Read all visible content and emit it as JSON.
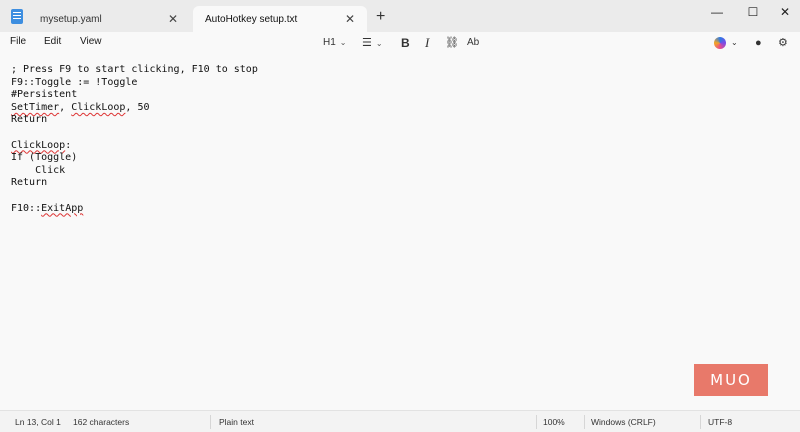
{
  "tabs": [
    {
      "label": "mysetup.yaml",
      "active": false
    },
    {
      "label": "AutoHotkey setup.txt",
      "active": true
    }
  ],
  "new_tab_glyph": "+",
  "tab_close_glyph": "✕",
  "window_controls": {
    "minimize": "—",
    "maximize": "☐",
    "close": "✕"
  },
  "menu": {
    "file": "File",
    "edit": "Edit",
    "view": "View"
  },
  "toolbar": {
    "heading": "H1",
    "list_glyph": "☰",
    "bold": "B",
    "italic": "I",
    "link_glyph": "⛓",
    "spellcheck": "Ab"
  },
  "code_lines": [
    [
      {
        "t": "; Press F9 to start clicking, F10 to stop"
      }
    ],
    [
      {
        "t": "F9::Toggle := !Toggle"
      }
    ],
    [
      {
        "t": "#Persistent"
      }
    ],
    [
      {
        "t": "SetTimer",
        "err": true
      },
      {
        "t": ", "
      },
      {
        "t": "ClickLoop",
        "err": true
      },
      {
        "t": ", 50"
      }
    ],
    [
      {
        "t": "Return"
      }
    ],
    [
      {
        "t": ""
      }
    ],
    [
      {
        "t": "ClickLoop",
        "err": true
      },
      {
        "t": ":"
      }
    ],
    [
      {
        "t": "If (Toggle)"
      }
    ],
    [
      {
        "t": "    Click"
      }
    ],
    [
      {
        "t": "Return"
      }
    ],
    [
      {
        "t": ""
      }
    ],
    [
      {
        "t": "F10::"
      },
      {
        "t": "ExitApp",
        "err": true
      }
    ]
  ],
  "watermark": "MUO",
  "status": {
    "position": "Ln 13, Col 1",
    "characters": "162 characters",
    "format": "Plain text",
    "zoom": "100%",
    "line_ending": "Windows (CRLF)",
    "encoding": "UTF-8"
  },
  "colors": {
    "accent": "#3d8ee0",
    "spell_error": "#dd3333",
    "watermark": "#e8796a"
  }
}
